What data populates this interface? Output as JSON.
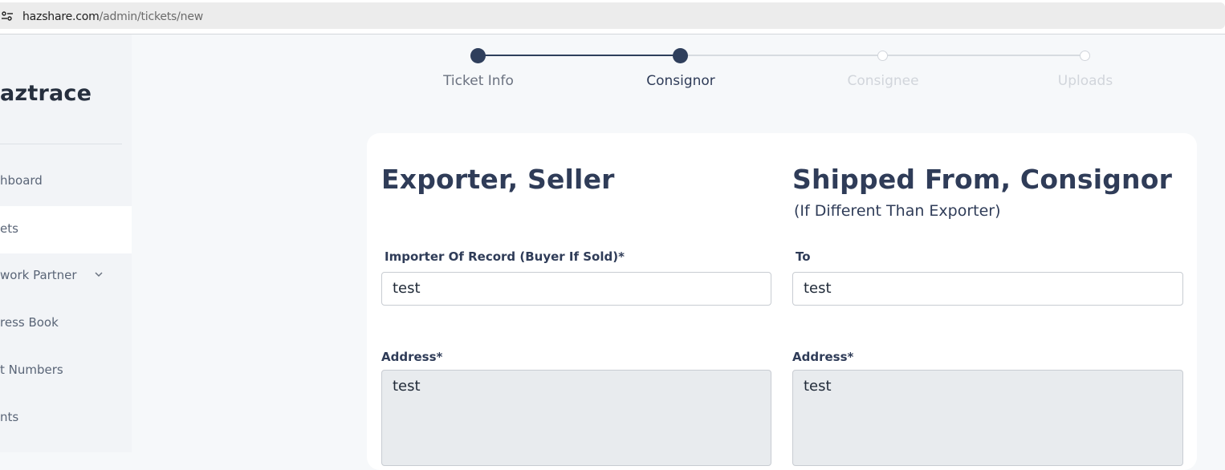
{
  "browser": {
    "url_host": "hazshare.com",
    "url_path": "/admin/tickets/new"
  },
  "sidebar": {
    "brand": "aztrace",
    "items": [
      {
        "label": "hboard",
        "icon": ""
      },
      {
        "label": "ets",
        "active": true
      },
      {
        "label": "work Partner",
        "expandable": true
      },
      {
        "label": "ress Book"
      },
      {
        "label": "t Numbers"
      },
      {
        "label": "nts"
      }
    ]
  },
  "stepper": {
    "steps": [
      {
        "label": "Ticket Info",
        "state": "complete"
      },
      {
        "label": "Consignor",
        "state": "current"
      },
      {
        "label": "Consignee",
        "state": "upcoming"
      },
      {
        "label": "Uploads",
        "state": "upcoming"
      }
    ],
    "colors": {
      "complete": "#2f3f5c",
      "upcoming": "#d1d5db",
      "label_done": "#6b7280",
      "label_current": "#2f3c58",
      "label_upcoming": "#d1d5db"
    }
  },
  "form": {
    "left": {
      "title": "Exporter, Seller",
      "importer_label": "Importer Of Record (Buyer If Sold)*",
      "importer_value": "test",
      "address_label": "Address*",
      "address_value": "test"
    },
    "right": {
      "title": "Shipped From, Consignor",
      "subtitle": "(If Different Than Exporter)",
      "to_label": "To",
      "to_value": "test",
      "address_label": "Address*",
      "address_value": "test"
    }
  }
}
